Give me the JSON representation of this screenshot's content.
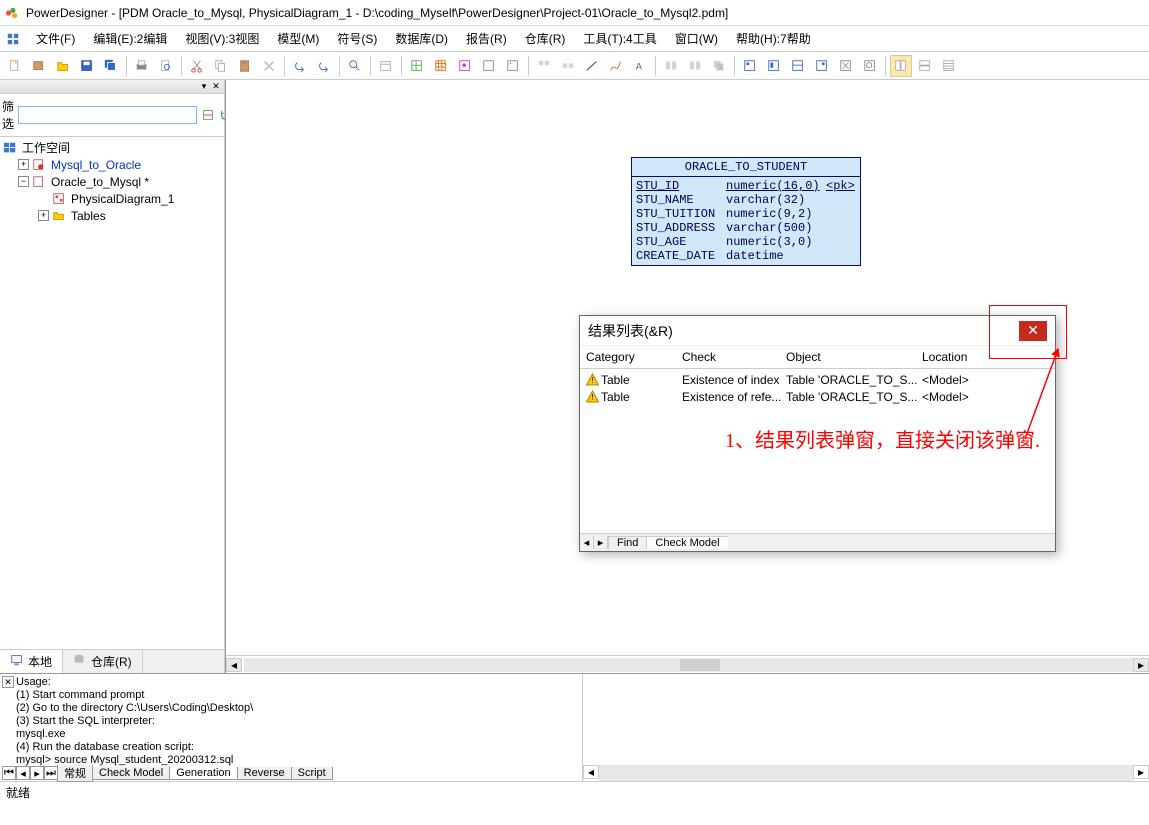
{
  "title": "PowerDesigner - [PDM Oracle_to_Mysql, PhysicalDiagram_1 - D:\\coding_Myself\\PowerDesigner\\Project-01\\Oracle_to_Mysql2.pdm]",
  "menu": {
    "file": "文件(F)",
    "edit": "编辑(E):2编辑",
    "view": "视图(V):3视图",
    "model": "模型(M)",
    "symbol": "符号(S)",
    "database": "数据库(D)",
    "report": "报告(R)",
    "repo": "仓库(R)",
    "tool": "工具(T):4工具",
    "window": "窗口(W)",
    "help": "帮助(H):7帮助"
  },
  "filter": {
    "label": "筛选",
    "value": ""
  },
  "tree": {
    "root": "工作空间",
    "n1": "Mysql_to_Oracle",
    "n2": "Oracle_to_Mysql *",
    "n3": "PhysicalDiagram_1",
    "n4": "Tables"
  },
  "sidebar_tabs": {
    "local": "本地",
    "repo": "仓库(R)"
  },
  "entity": {
    "name": "ORACLE_TO_STUDENT",
    "cols": [
      {
        "name": "STU_ID",
        "type": "numeric(16,0)",
        "key": "<pk>"
      },
      {
        "name": "STU_NAME",
        "type": "varchar(32)",
        "key": ""
      },
      {
        "name": "STU_TUITION",
        "type": "numeric(9,2)",
        "key": ""
      },
      {
        "name": "STU_ADDRESS",
        "type": "varchar(500)",
        "key": ""
      },
      {
        "name": "STU_AGE",
        "type": "numeric(3,0)",
        "key": ""
      },
      {
        "name": "CREATE_DATE",
        "type": "datetime",
        "key": ""
      }
    ]
  },
  "dialog": {
    "title": "结果列表(&R)",
    "headers": {
      "cat": "Category",
      "check": "Check",
      "obj": "Object",
      "loc": "Location"
    },
    "rows": [
      {
        "cat": "Table",
        "check": "Existence of index",
        "obj": "Table 'ORACLE_TO_S...",
        "loc": "<Model>"
      },
      {
        "cat": "Table",
        "check": "Existence of refe...",
        "obj": "Table 'ORACLE_TO_S...",
        "loc": "<Model>"
      }
    ],
    "tabs": {
      "find": "Find",
      "checkmodel": "Check Model"
    }
  },
  "annotation": "1、结果列表弹窗，直接关闭该弹窗.",
  "output": {
    "lines": [
      "Usage:",
      " (1) Start command prompt",
      " (2) Go to the directory C:\\Users\\Coding\\Desktop\\",
      " (3) Start the SQL interpreter:",
      "      mysql.exe",
      " (4) Run the database creation script:",
      "      mysql> source Mysql_student_20200312.sql"
    ],
    "tabs": {
      "general": "常规",
      "checkmodel": "Check Model",
      "generation": "Generation",
      "reverse": "Reverse",
      "script": "Script"
    }
  },
  "status": "就绪"
}
